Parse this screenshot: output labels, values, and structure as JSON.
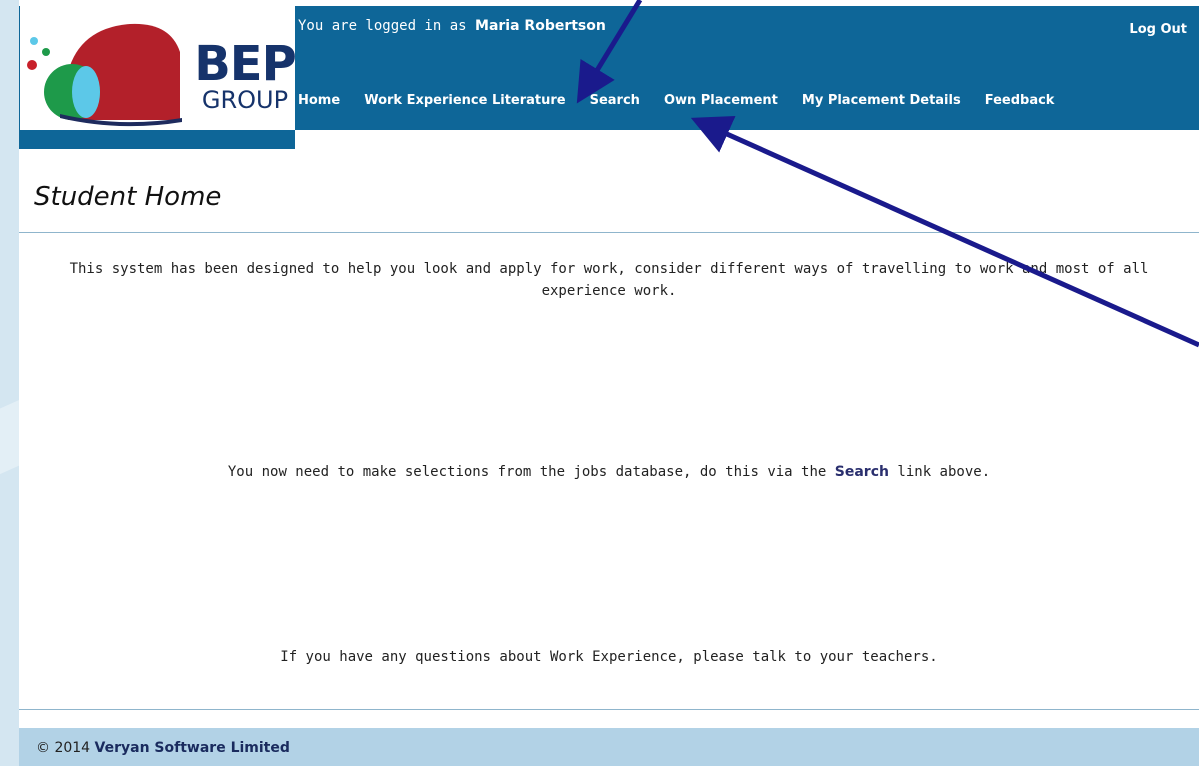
{
  "logo": {
    "word": "BEP",
    "subword": "GROUP"
  },
  "header": {
    "login_prefix": "You are logged in as",
    "user_name": "Maria Robertson",
    "logout": "Log Out",
    "nav": [
      "Home",
      "Work Experience Literature",
      "Search",
      "Own Placement",
      "My Placement Details",
      "Feedback"
    ]
  },
  "main": {
    "title": "Student Home",
    "intro": "This system has been designed to help you look and apply for work, consider different ways of travelling to work and most of all experience work.",
    "instruction_before": "You now need to make selections from the jobs database, do this via the",
    "instruction_link": "Search",
    "instruction_after": "link above.",
    "questions": "If you have any questions about Work Experience, please talk to your teachers."
  },
  "footer": {
    "copyright": "© 2014",
    "company": "Veryan Software Limited"
  },
  "colors": {
    "header": "#0e6698",
    "footer": "#b2d2e6",
    "arrow": "#1a1a8c",
    "logo_red": "#b3202a",
    "logo_green": "#1e9a4a",
    "logo_cyan": "#5cc8e8"
  }
}
